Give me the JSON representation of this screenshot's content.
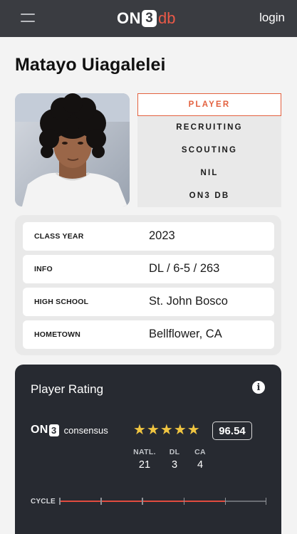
{
  "header": {
    "logo_on": "ON",
    "logo_three": "3",
    "logo_db": "db",
    "login_label": "login"
  },
  "player": {
    "name": "Matayo Uiagalelei"
  },
  "tabs": [
    {
      "label": "PLAYER",
      "active": true
    },
    {
      "label": "RECRUITING",
      "active": false
    },
    {
      "label": "SCOUTING",
      "active": false
    },
    {
      "label": "NIL",
      "active": false
    },
    {
      "label": "ON3 DB",
      "active": false
    }
  ],
  "info": [
    {
      "label": "CLASS YEAR",
      "value": "2023"
    },
    {
      "label": "INFO",
      "value": "DL / 6-5 / 263"
    },
    {
      "label": "HIGH SCHOOL",
      "value": "St. John Bosco"
    },
    {
      "label": "HOMETOWN",
      "value": "Bellflower, CA"
    }
  ],
  "rating": {
    "title": "Player Rating",
    "brand_on": "ON",
    "brand_three": "3",
    "brand_consensus": "consensus",
    "stars": 5,
    "score": "96.54",
    "ranks": [
      {
        "label": "NATL.",
        "value": "21"
      },
      {
        "label": "DL",
        "value": "3"
      },
      {
        "label": "CA",
        "value": "4"
      }
    ],
    "cycle_label": "CYCLE",
    "cycle_progress": 0.8,
    "cycle_segments": 5
  },
  "colors": {
    "topbar": "#3a3c41",
    "accent": "#e3613f",
    "logo_db": "#ea5948",
    "star": "#f0c541",
    "card_dark": "#272a31",
    "cycle_fill": "#e14b3f"
  },
  "icons": {
    "menu": "hamburger-menu-icon",
    "info": "info-circle-icon",
    "star": "star-icon"
  }
}
